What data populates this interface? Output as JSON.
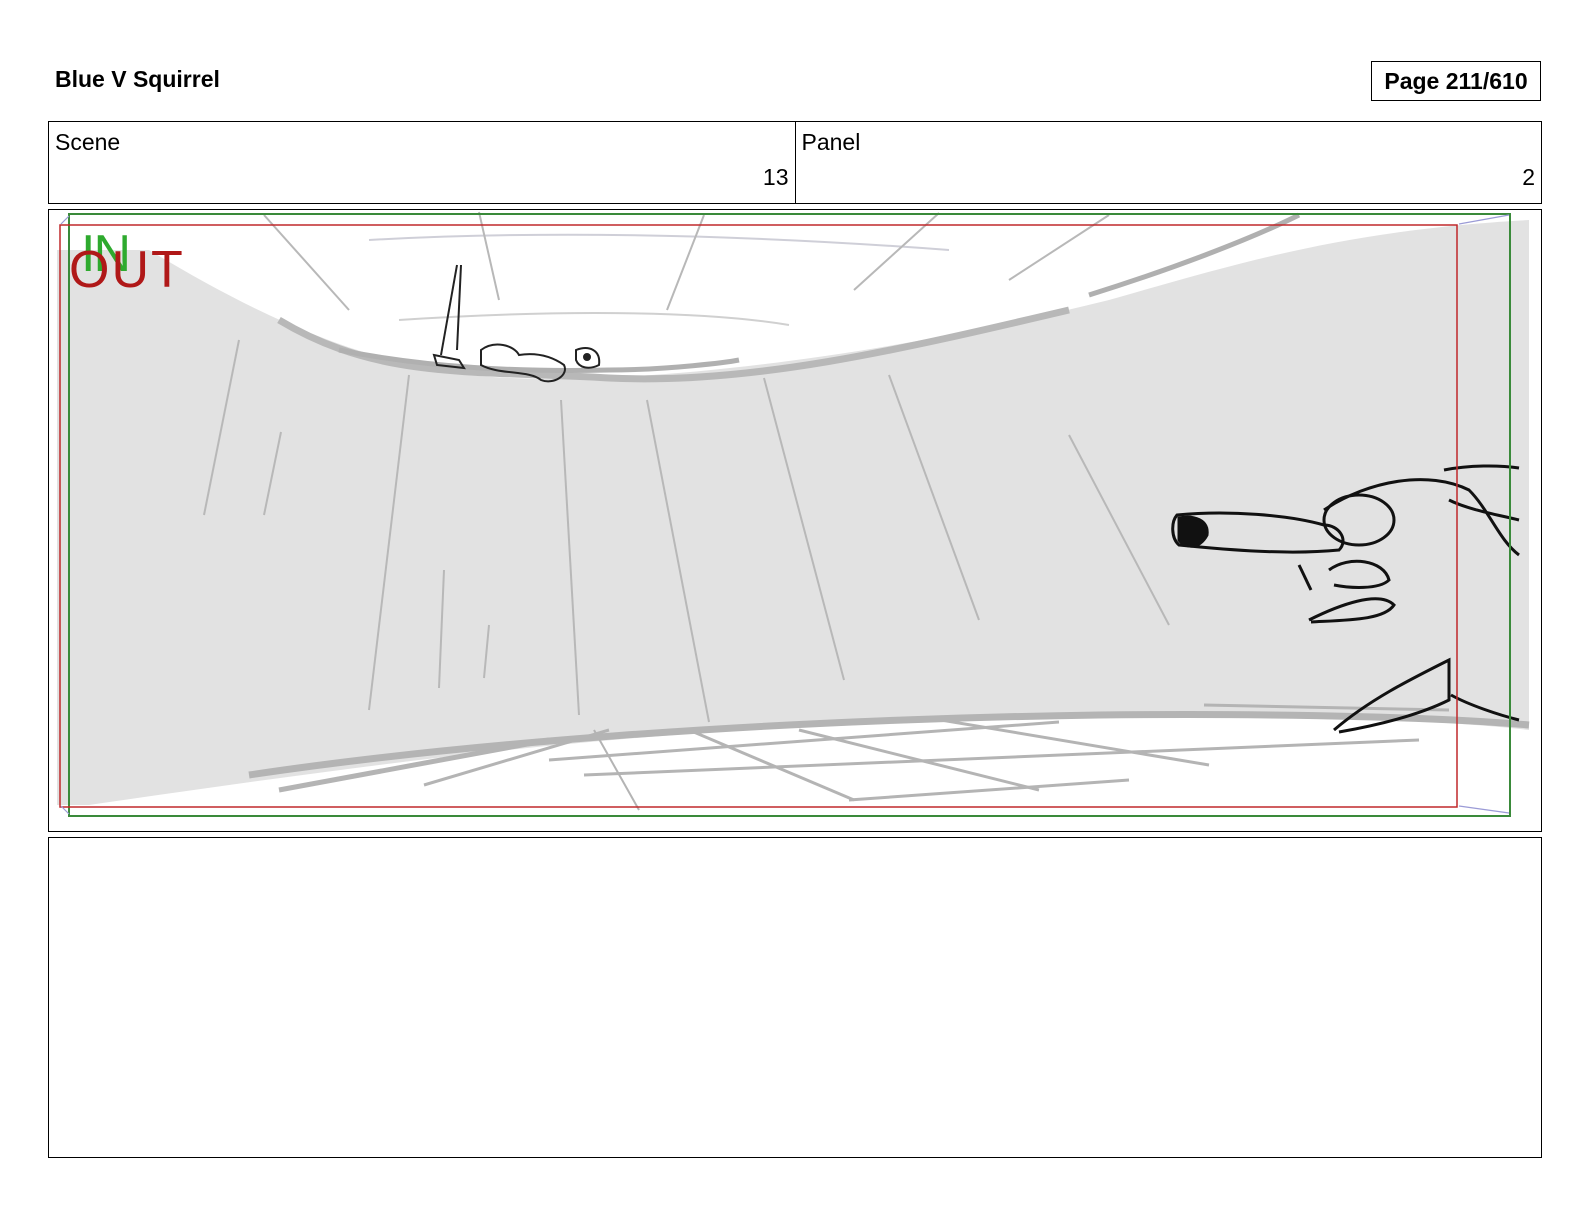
{
  "header": {
    "title": "Blue V Squirrel",
    "page_label": "Page 211/610"
  },
  "info": {
    "scene_label": "Scene",
    "scene_value": "13",
    "panel_label": "Panel",
    "panel_value": "2"
  },
  "panel": {
    "in_marker": "IN",
    "out_marker": "OUT"
  },
  "notes": {
    "text": ""
  },
  "colors": {
    "safe_frame_green": "#3a8a3a",
    "action_frame_red": "#c0282b",
    "sketch_gray": "#e2e2e2",
    "in_text": "#2eaa2e",
    "out_text": "#b01818"
  }
}
